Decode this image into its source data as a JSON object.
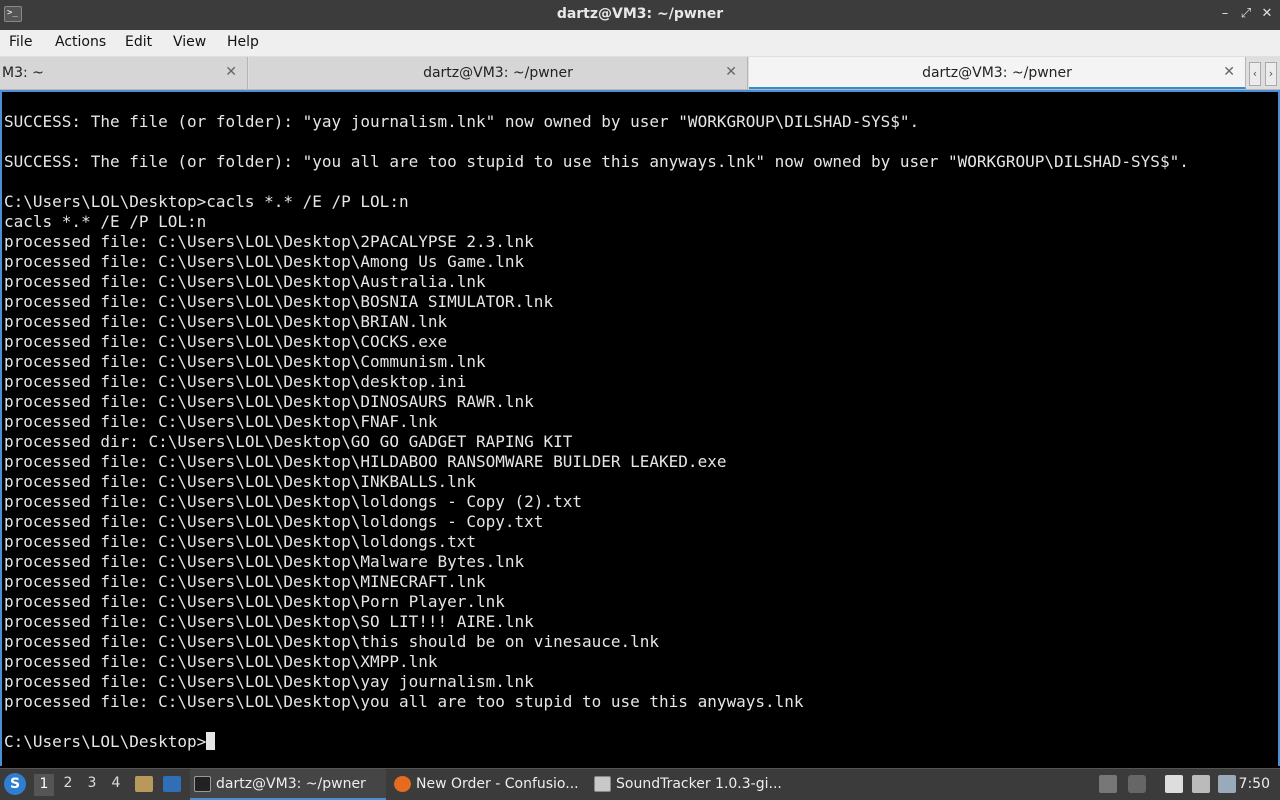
{
  "window": {
    "title": "dartz@VM3: ~/pwner",
    "minimize": "–",
    "maximize": "⤢",
    "close": "✕"
  },
  "menu": [
    "File",
    "Actions",
    "Edit",
    "View",
    "Help"
  ],
  "tabs": [
    {
      "label": "M3: ~",
      "close": "✕"
    },
    {
      "label": "dartz@VM3: ~/pwner",
      "close": "✕"
    },
    {
      "label": "dartz@VM3: ~/pwner",
      "close": "✕"
    }
  ],
  "tab_scroll": {
    "left": "‹",
    "right": "›"
  },
  "terminal": {
    "lines": [
      "SUCCESS: The file (or folder): \"yay journalism.lnk\" now owned by user \"WORKGROUP\\DILSHAD-SYS$\".",
      "",
      "SUCCESS: The file (or folder): \"you all are too stupid to use this anyways.lnk\" now owned by user \"WORKGROUP\\DILSHAD-SYS$\".",
      "",
      "C:\\Users\\LOL\\Desktop>cacls *.* /E /P LOL:n",
      "cacls *.* /E /P LOL:n",
      "processed file: C:\\Users\\LOL\\Desktop\\2PACALYPSE 2.3.lnk",
      "processed file: C:\\Users\\LOL\\Desktop\\Among Us Game.lnk",
      "processed file: C:\\Users\\LOL\\Desktop\\Australia.lnk",
      "processed file: C:\\Users\\LOL\\Desktop\\BOSNIA SIMULATOR.lnk",
      "processed file: C:\\Users\\LOL\\Desktop\\BRIAN.lnk",
      "processed file: C:\\Users\\LOL\\Desktop\\COCKS.exe",
      "processed file: C:\\Users\\LOL\\Desktop\\Communism.lnk",
      "processed file: C:\\Users\\LOL\\Desktop\\desktop.ini",
      "processed file: C:\\Users\\LOL\\Desktop\\DINOSAURS RAWR.lnk",
      "processed file: C:\\Users\\LOL\\Desktop\\FNAF.lnk",
      "processed dir: C:\\Users\\LOL\\Desktop\\GO GO GADGET RAPING KIT",
      "processed file: C:\\Users\\LOL\\Desktop\\HILDABOO RANSOMWARE BUILDER LEAKED.exe",
      "processed file: C:\\Users\\LOL\\Desktop\\INKBALLS.lnk",
      "processed file: C:\\Users\\LOL\\Desktop\\loldongs - Copy (2).txt",
      "processed file: C:\\Users\\LOL\\Desktop\\loldongs - Copy.txt",
      "processed file: C:\\Users\\LOL\\Desktop\\loldongs.txt",
      "processed file: C:\\Users\\LOL\\Desktop\\Malware Bytes.lnk",
      "processed file: C:\\Users\\LOL\\Desktop\\MINECRAFT.lnk",
      "processed file: C:\\Users\\LOL\\Desktop\\Porn Player.lnk",
      "processed file: C:\\Users\\LOL\\Desktop\\SO LIT!!! AIRE.lnk",
      "processed file: C:\\Users\\LOL\\Desktop\\this should be on vinesauce.lnk",
      "processed file: C:\\Users\\LOL\\Desktop\\XMPP.lnk",
      "processed file: C:\\Users\\LOL\\Desktop\\yay journalism.lnk",
      "processed file: C:\\Users\\LOL\\Desktop\\you all are too stupid to use this anyways.lnk",
      ""
    ],
    "prompt": "C:\\Users\\LOL\\Desktop>"
  },
  "taskbar": {
    "start_icon": "debian-swirl-icon",
    "start_glyph": "S",
    "workspaces": [
      "1",
      "2",
      "3",
      "4"
    ],
    "tasks": [
      {
        "label": "dartz@VM3: ~/pwner",
        "icon": "terminal-icon"
      },
      {
        "label": "New Order - Confusio...",
        "icon": "firefox-icon"
      },
      {
        "label": "SoundTracker 1.0.3-gi...",
        "icon": "window-icon"
      }
    ],
    "clock": "7:50"
  },
  "colors": {
    "accent": "#4a90d9",
    "terminal_bg": "#000000",
    "terminal_fg": "#e6e6e6"
  }
}
